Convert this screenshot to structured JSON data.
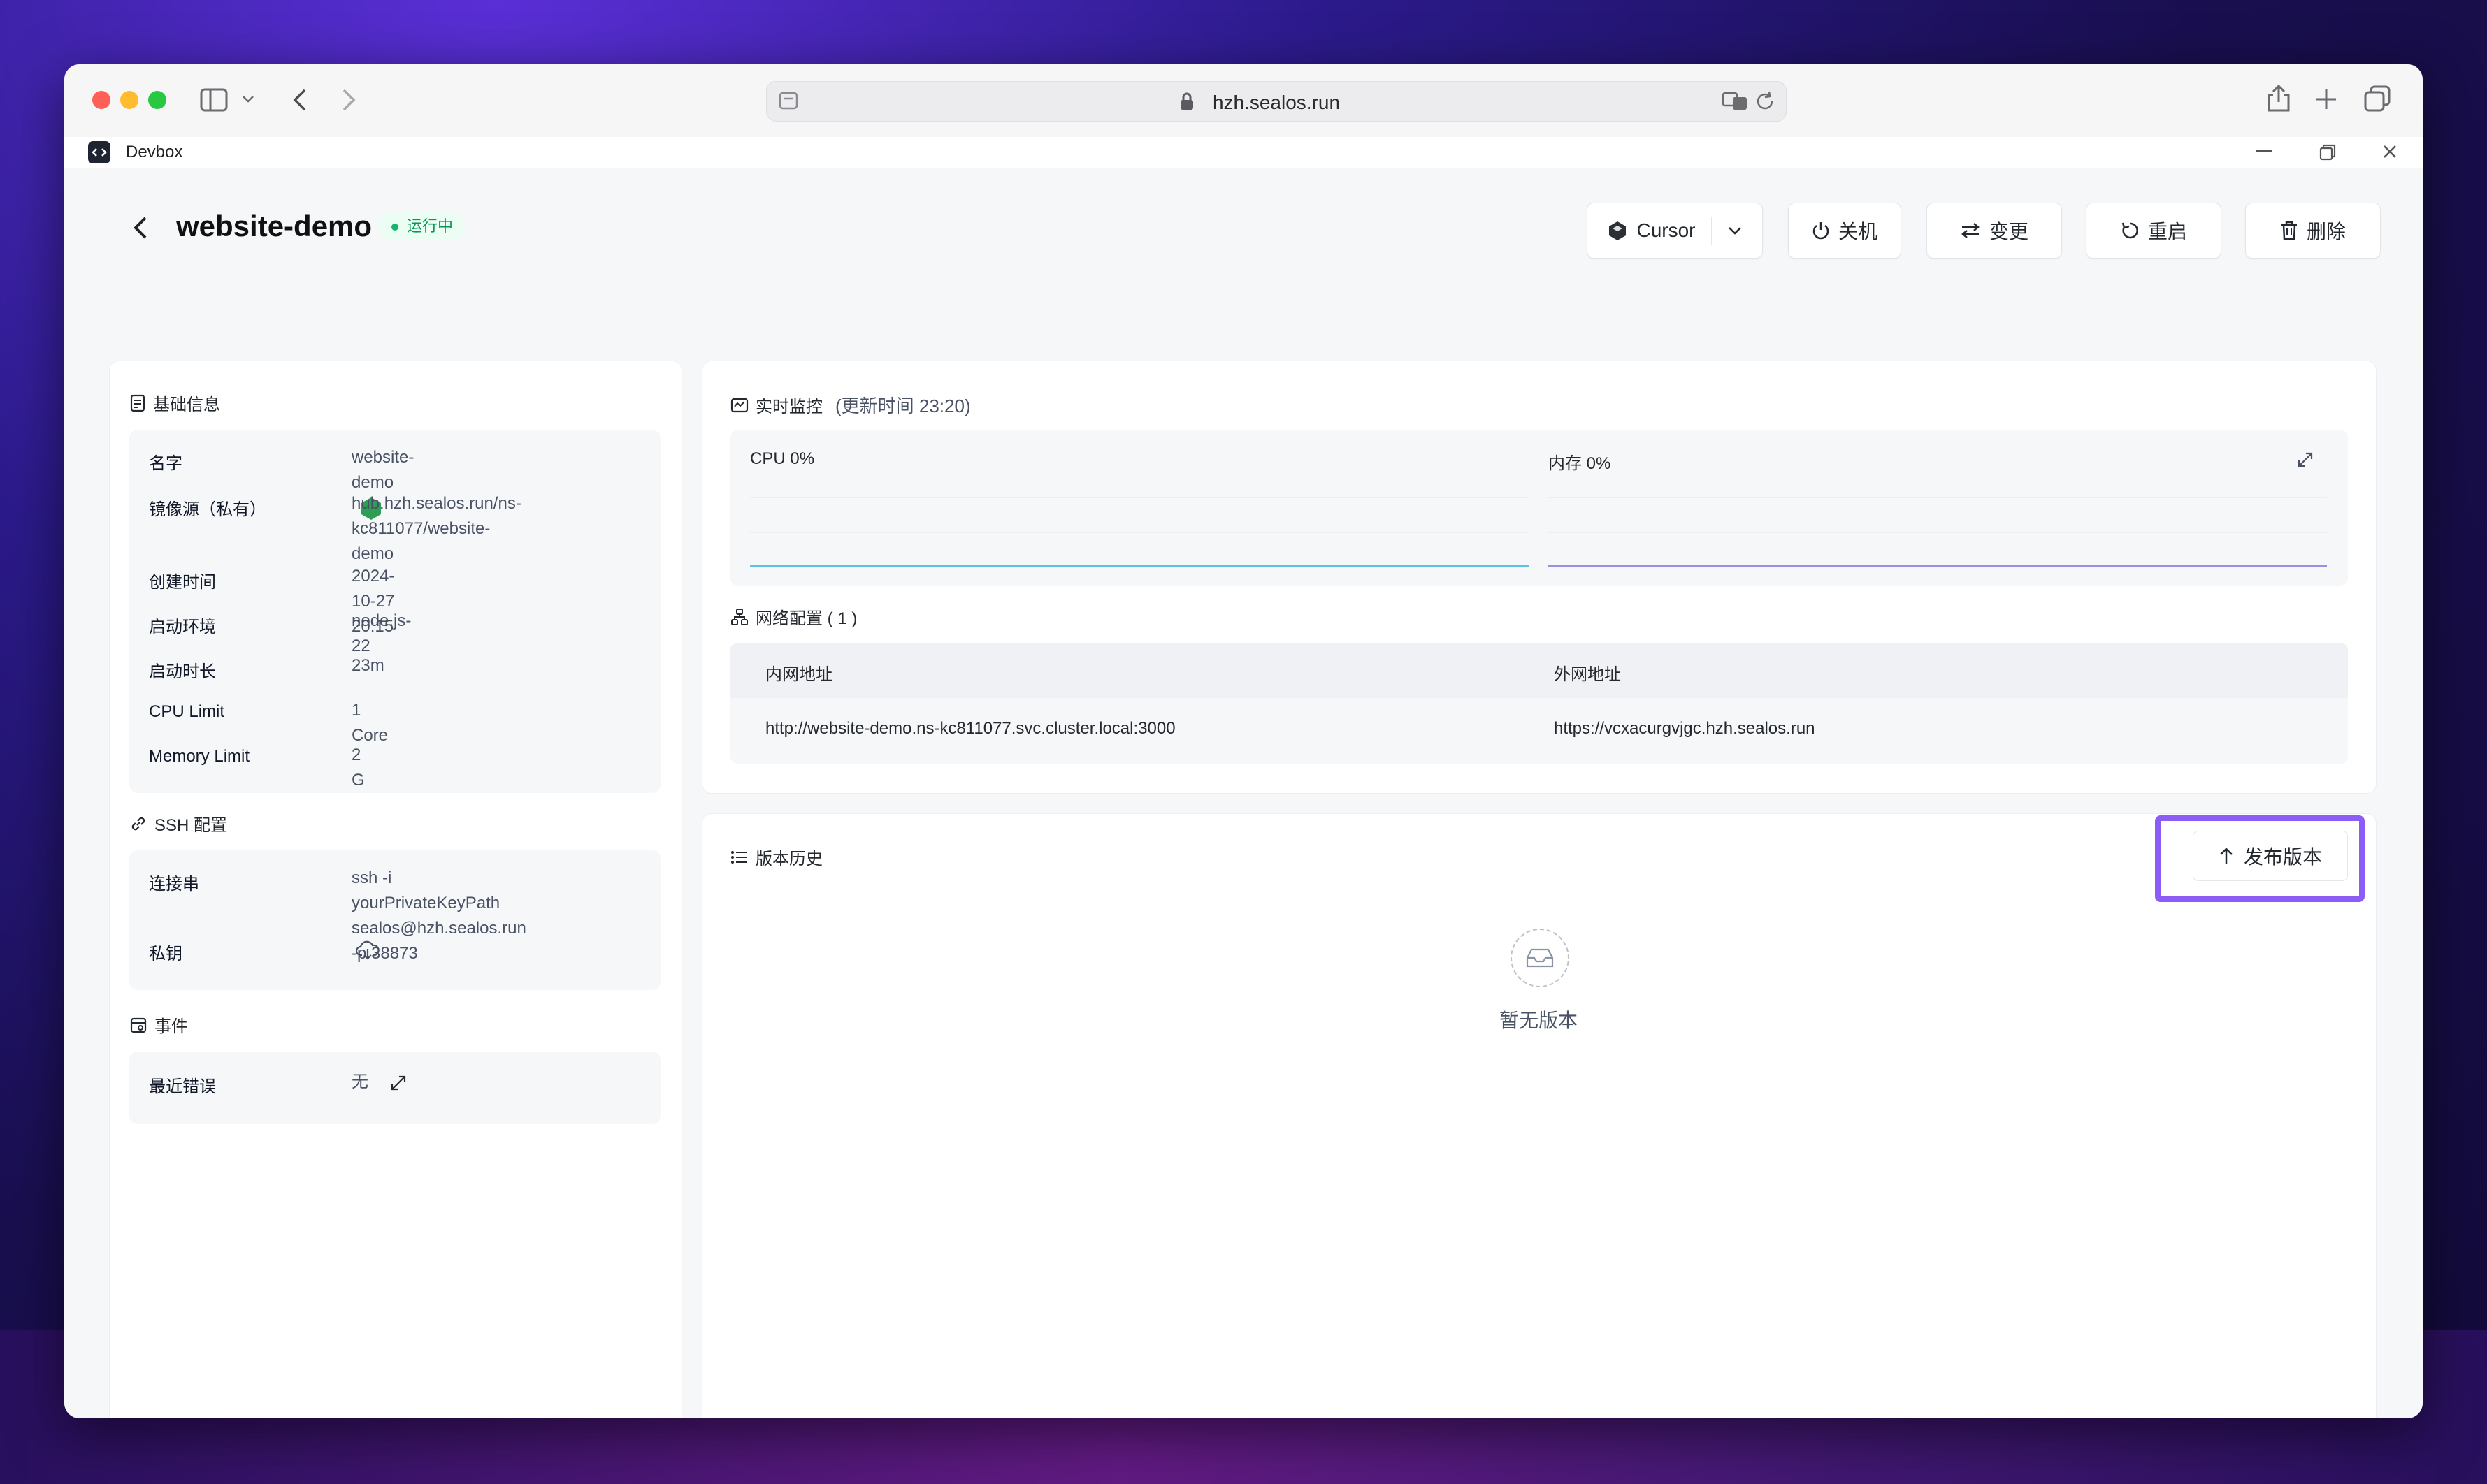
{
  "browser": {
    "url": "hzh.sealos.run",
    "colors": {
      "close": "#ff5f57",
      "minimize": "#febc2e",
      "zoom": "#28c840"
    }
  },
  "app": {
    "name": "Devbox"
  },
  "header": {
    "title": "website-demo",
    "status": "运行中",
    "actions": {
      "ide": "Cursor",
      "shutdown": "关机",
      "change": "变更",
      "restart": "重启",
      "delete": "删除"
    }
  },
  "basic": {
    "title": "基础信息",
    "rows": [
      {
        "k": "名字",
        "v": "website-demo"
      },
      {
        "k": "镜像源（私有）",
        "v": "hub.hzh.sealos.run/ns-",
        "v2": "kc811077/website-demo"
      },
      {
        "k": "创建时间",
        "v": "2024-10-27 20:15"
      },
      {
        "k": "启动环境",
        "v": "node.js-22"
      },
      {
        "k": "启动时长",
        "v": "23m"
      },
      {
        "k": "CPU Limit",
        "v": "1 Core"
      },
      {
        "k": "Memory Limit",
        "v": "2 G"
      }
    ]
  },
  "ssh": {
    "title": "SSH 配置",
    "conn_label": "连接串",
    "conn_line1": "ssh -i yourPrivateKeyPath",
    "conn_line2": "sealos@hzh.sealos.run -p 38873",
    "key_label": "私钥"
  },
  "events": {
    "title": "事件",
    "label": "最近错误",
    "value": "无"
  },
  "monitor": {
    "title": "实时监控",
    "updated": "(更新时间  23:20)",
    "cpu_label": "CPU 0%",
    "mem_label": "内存 0%",
    "cpu_color": "#5ec2e3",
    "mem_color": "#9c8ee6"
  },
  "network": {
    "title": "网络配置 ( 1 )",
    "col_internal": "内网地址",
    "col_external": "外网地址",
    "internal": "http://website-demo.ns-kc811077.svc.cluster.local:3000",
    "external": "https://vcxacurgvjgc.hzh.sealos.run"
  },
  "versions": {
    "title": "版本历史",
    "publish": "发布版本",
    "empty": "暂无版本",
    "highlight_color": "#8b5cf6"
  }
}
